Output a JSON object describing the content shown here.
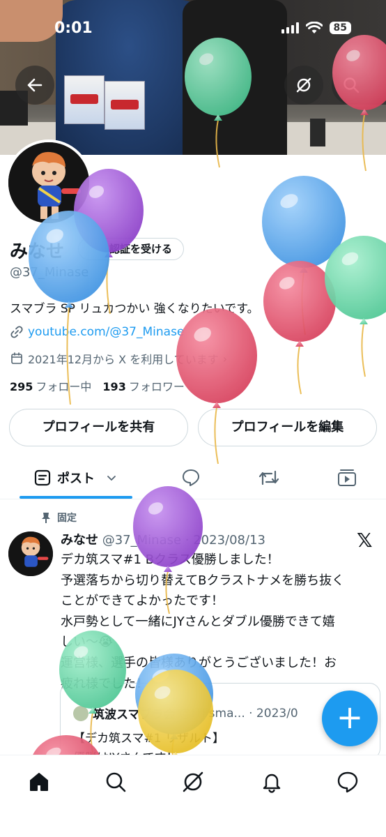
{
  "status_bar": {
    "time": "0:01",
    "battery": "85"
  },
  "profile": {
    "display_name": "みなせ",
    "verify_label": "認証を受ける",
    "handle": "@37_Minase",
    "bio": "スマブラ SP リュカつかい 強くなりたいです。",
    "link": "youtube.com/@37_Minase",
    "joined": "2021年12月から X を利用しています",
    "joined_chevron": "›",
    "following_count": "295",
    "following_label": "フォロー中",
    "followers_count": "193",
    "followers_label": "フォロワー",
    "share_label": "プロフィールを共有",
    "edit_label": "プロフィールを編集"
  },
  "tabs": {
    "posts_label": "ポスト"
  },
  "pinned_post": {
    "pinned_label": "固定",
    "author": "みなせ",
    "handle_date": "@37_Minase · 2023/08/13",
    "lines": [
      "デカ筑スマ#1 Bクラス優勝しました！",
      "予選落ちから切り替えてBクラストナメを勝ち抜く",
      "ことができてよかったです！",
      "水戸勢として一緒にJYさんとダブル優勝できて嬉",
      "しい〜😭",
      "運営様、選手の皆様ありがとうございました！お",
      "疲れ様でした！"
    ],
    "quote": {
      "author": "筑波スマブラ会",
      "handle_date": "@ITFsma... · 2023/0",
      "line1": "【デカ筑スマ#1 リザルト】",
      "line2": "優勝はJYさんです！"
    }
  },
  "fab_label": "+",
  "colors": {
    "accent": "#1d9bf0",
    "balloon_green": "#5fd6a2",
    "balloon_red": "#e0506a",
    "balloon_purple": "#9b4fd6",
    "balloon_blue": "#4da6ee",
    "balloon_yellow": "#f0cf3e"
  }
}
